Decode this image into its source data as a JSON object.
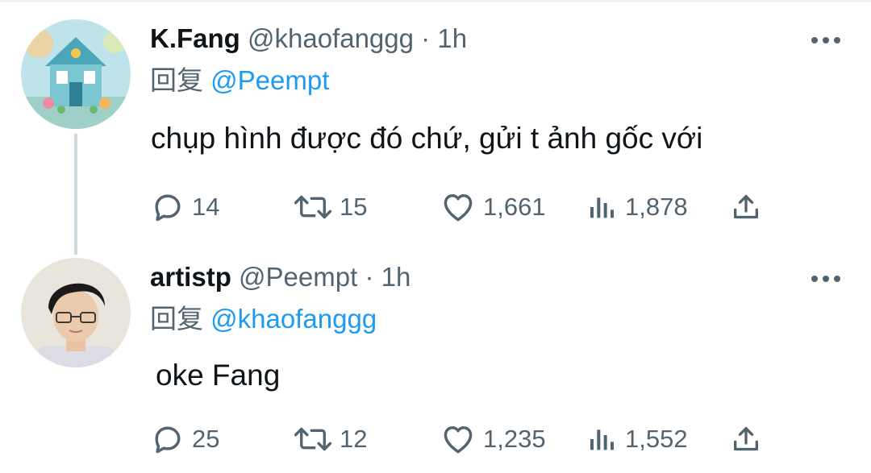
{
  "tweets": [
    {
      "name": "K.Fang",
      "handle": "@khaofanggg",
      "time": "1h",
      "reply_label": "回复",
      "reply_handle": "@Peempt",
      "text": "chụp hình được đó chứ, gửi t ảnh gốc với",
      "stats": {
        "replies": "14",
        "retweets": "15",
        "likes": "1,661",
        "views": "1,878"
      },
      "avatar": "house-illustration-avatar"
    },
    {
      "name": "artistp",
      "handle": "@Peempt",
      "time": "1h",
      "reply_label": "回复",
      "reply_handle": "@khaofanggg",
      "text": "oke Fang",
      "stats": {
        "replies": "25",
        "retweets": "12",
        "likes": "1,235",
        "views": "1,552"
      },
      "avatar": "person-photo-avatar"
    }
  ],
  "separator": "·",
  "icons": [
    "comment-icon",
    "retweet-icon",
    "heart-icon",
    "views-icon",
    "share-icon",
    "more-icon"
  ],
  "colors": {
    "text": "#0f1419",
    "secondary": "#536471",
    "link": "#1d9bf0",
    "thread_line": "#cfd9de"
  }
}
